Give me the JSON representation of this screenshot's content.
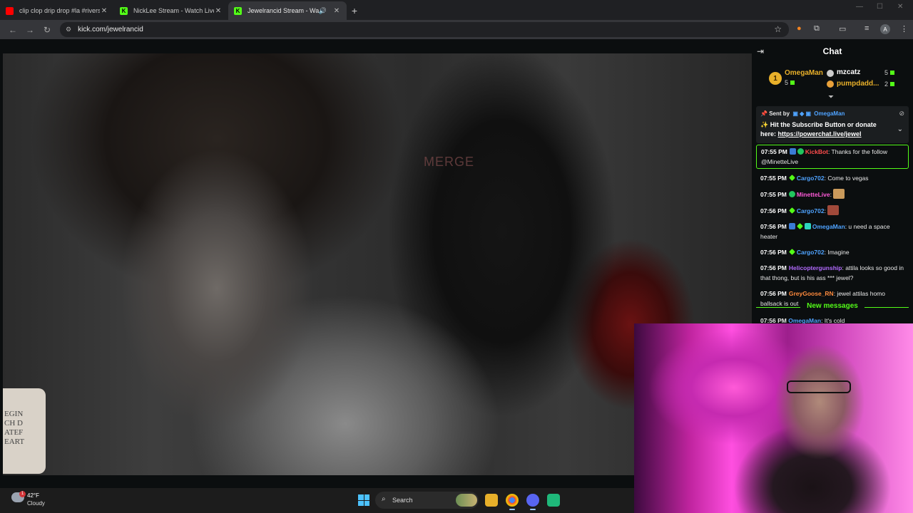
{
  "browser": {
    "tabs": [
      {
        "title": "clip clop drip drop #la #riversid",
        "favicon_color": "#ff0000",
        "active": false
      },
      {
        "title": "NickLee Stream - Watch Live on",
        "favicon_color": "#53fc18",
        "active": false
      },
      {
        "title": "Jewelrancid Stream - Watch",
        "favicon_color": "#53fc18",
        "active": true
      }
    ],
    "new_tab": "+",
    "url": "kick.com/jewelrancid",
    "profile_initial": "A"
  },
  "stream": {
    "chair_text": "MERGE",
    "mug_text": [
      "EGIN",
      "CH D",
      "ATEF",
      "EART"
    ]
  },
  "chat": {
    "title": "Chat",
    "leaderboard": [
      {
        "rank": "1",
        "name": "OmegaMan",
        "count": "5",
        "color": "#e9b02a"
      },
      {
        "name": "mzcatz",
        "count": "5",
        "color": "#ffffff"
      },
      {
        "name": "pumpdadd...",
        "count": "2",
        "color": "#e9b02a"
      }
    ],
    "pinned": {
      "sent_by_label": "Sent by",
      "sender": "OmegaMan",
      "message": "✨ Hit the Subscribe Button or donate here: ",
      "link": "https://powerchat.live/jewel"
    },
    "messages": [
      {
        "time": "07:55 PM",
        "user": "KickBot",
        "color": "#ff4d4d",
        "badges": [
          "b-blue",
          "b-tealround"
        ],
        "text": ": Thanks for the follow @MinetteLive",
        "highlight": true
      },
      {
        "time": "07:55 PM",
        "user": "Cargo702",
        "color": "#4fa3ff",
        "badges": [
          "b-green"
        ],
        "text": ": Come to vegas"
      },
      {
        "time": "07:55 PM",
        "user": "MinetteLive",
        "color": "#ff5ad8",
        "badges": [
          "b-tealround"
        ],
        "text": ":",
        "emote": "#c99a5b"
      },
      {
        "time": "07:56 PM",
        "user": "Cargo702",
        "color": "#4fa3ff",
        "badges": [
          "b-green"
        ],
        "text": ":",
        "emote": "#a0493a"
      },
      {
        "time": "07:56 PM",
        "user": "OmegaMan",
        "color": "#4fa3ff",
        "badges": [
          "b-blue",
          "b-green",
          "b-cyan"
        ],
        "text": ": u need a space heater"
      },
      {
        "time": "07:56 PM",
        "user": "Cargo702",
        "color": "#4fa3ff",
        "badges": [
          "b-green"
        ],
        "text": ": Imagine"
      },
      {
        "time": "07:56 PM",
        "user": "Helicoptergunship",
        "color": "#b36bff",
        "badges": [],
        "text": ": attila looks so good in that thong, but is his ass *** jewel?"
      },
      {
        "time": "07:56 PM",
        "user": "GreyGoose_RN",
        "color": "#ff8a3d",
        "badges": [],
        "text": ": jewel attilas homo ballsack is out"
      }
    ],
    "new_messages_label": "New messages",
    "last_message": {
      "time": "07:56 PM",
      "user": "OmegaMan",
      "text": ": It's cold"
    }
  },
  "taskbar": {
    "temperature": "42°F",
    "condition": "Cloudy",
    "weather_badge": "1",
    "search_label": "Search"
  }
}
